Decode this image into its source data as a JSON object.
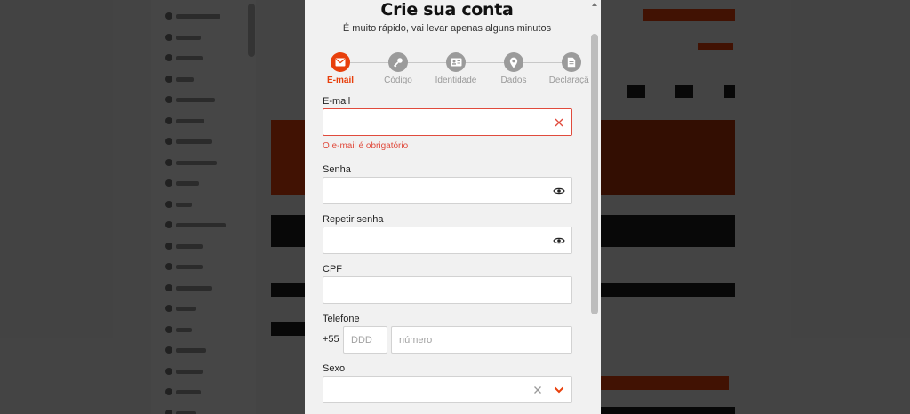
{
  "modal": {
    "title": "Crie sua conta",
    "subtitle": "É muito rápido, vai levar apenas alguns minutos",
    "steps": [
      {
        "label": "E-mail",
        "icon": "envelope-icon",
        "active": true
      },
      {
        "label": "Código",
        "icon": "key-icon",
        "active": false
      },
      {
        "label": "Identidade",
        "icon": "id-card-icon",
        "active": false
      },
      {
        "label": "Dados",
        "icon": "map-pin-icon",
        "active": false
      },
      {
        "label": "Declaração",
        "icon": "document-icon",
        "active": false
      }
    ],
    "email": {
      "label": "E-mail",
      "value": "",
      "placeholder": "",
      "error": "O e-mail é obrigatório"
    },
    "password": {
      "label": "Senha",
      "value": "",
      "placeholder": ""
    },
    "repeat_password": {
      "label": "Repetir senha",
      "value": "",
      "placeholder": ""
    },
    "cpf": {
      "label": "CPF",
      "value": "",
      "placeholder": ""
    },
    "phone": {
      "label": "Telefone",
      "prefix": "+55",
      "ddd_placeholder": "DDD",
      "number_placeholder": "número"
    },
    "sex": {
      "label": "Sexo",
      "value": ""
    }
  },
  "colors": {
    "accent": "#e8400c",
    "error": "#e04a3c",
    "step_inactive": "#9b9b9b"
  }
}
